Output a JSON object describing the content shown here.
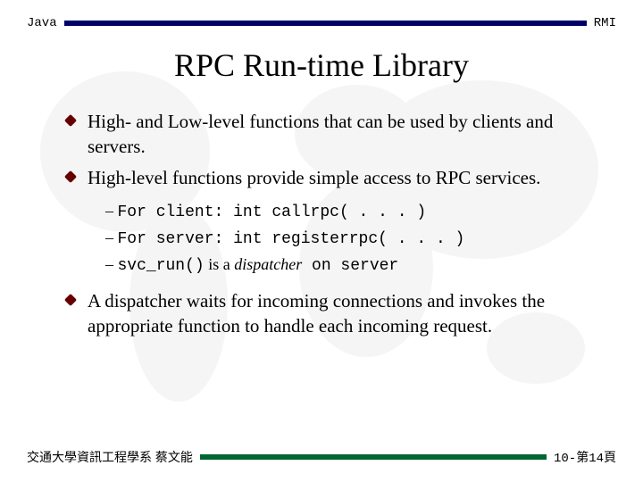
{
  "header": {
    "left": "Java",
    "right": "RMI"
  },
  "title": "RPC Run-time Library",
  "bullets": {
    "b1": "High- and Low-level functions that can be used by clients and servers.",
    "b2": "High-level functions provide simple access to RPC services.",
    "sub1": "For client: int callrpc( . . . )",
    "sub2": "For server: int registerrpc( . . . )",
    "sub3_code1": "svc_run()",
    "sub3_mid": " is a ",
    "sub3_italic": "dispatcher",
    "sub3_code2": " on server",
    "b3": "A dispatcher waits for incoming connections and invokes the appropriate  function to handle each incoming request."
  },
  "footer": {
    "left": "交通大學資訊工程學系 蔡文能",
    "right": "10-第14頁"
  }
}
